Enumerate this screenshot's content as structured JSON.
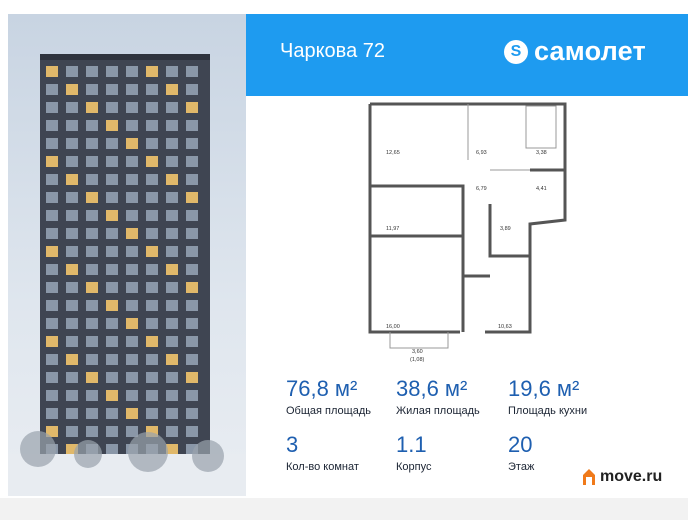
{
  "header": {
    "address": "Чаркова 72",
    "brand": "самолет",
    "brand_badge": "S"
  },
  "plan_rooms": [
    "12,65",
    "6,93",
    "3,38",
    "6,79",
    "4,41",
    "11,97",
    "3,89",
    "16,00",
    "10,63",
    "3,60",
    "(1,08)"
  ],
  "stats": {
    "total_area": {
      "value": "76,8 м²",
      "label": "Общая площадь"
    },
    "living_area": {
      "value": "38,6 м²",
      "label": "Жилая площадь"
    },
    "kitchen_area": {
      "value": "19,6 м²",
      "label": "Площадь кухни"
    },
    "rooms": {
      "value": "3",
      "label": "Кол-во комнат"
    },
    "building": {
      "value": "1.1",
      "label": "Корпус"
    },
    "floor": {
      "value": "20",
      "label": "Этаж"
    }
  },
  "footer_brand": {
    "name": "move.ru"
  },
  "colors": {
    "header": "#1e9bf0",
    "stat_values": "#1e5fb0",
    "move_accent": "#f07a1a"
  }
}
